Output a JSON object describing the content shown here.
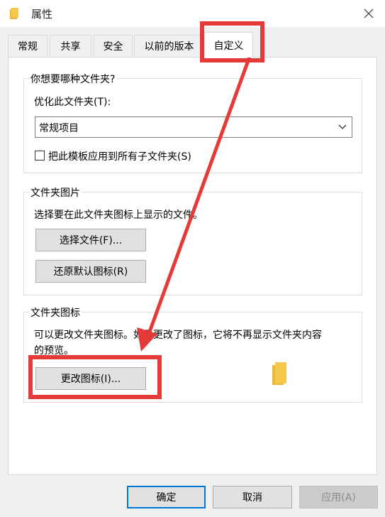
{
  "window": {
    "title": "属性"
  },
  "tabs": [
    {
      "label": "常规"
    },
    {
      "label": "共享"
    },
    {
      "label": "安全"
    },
    {
      "label": "以前的版本"
    },
    {
      "label": "自定义"
    }
  ],
  "folder_type": {
    "group_title": "你想要哪种文件夹?",
    "optimize_label": "优化此文件夹(T):",
    "optimize_value": "常规项目",
    "apply_label": "把此模板应用到所有子文件夹(S)"
  },
  "folder_picture": {
    "group_title": "文件夹图片",
    "desc": "选择要在此文件夹图标上显示的文件。",
    "choose_file": "选择文件(F)...",
    "restore_default": "还原默认图标(R)"
  },
  "folder_icon": {
    "group_title": "文件夹图标",
    "desc_line1": "可以更改文件夹图标。如果更改了图标，它将不再显示文件夹内容",
    "desc_line2": "的预览。",
    "change_icon": "更改图标(I)..."
  },
  "footer": {
    "ok": "确定",
    "cancel": "取消",
    "apply": "应用(A)"
  },
  "colors": {
    "highlight": "#e53a3a",
    "select_bg": "#cce8ff",
    "folder": "#f5c84c"
  }
}
